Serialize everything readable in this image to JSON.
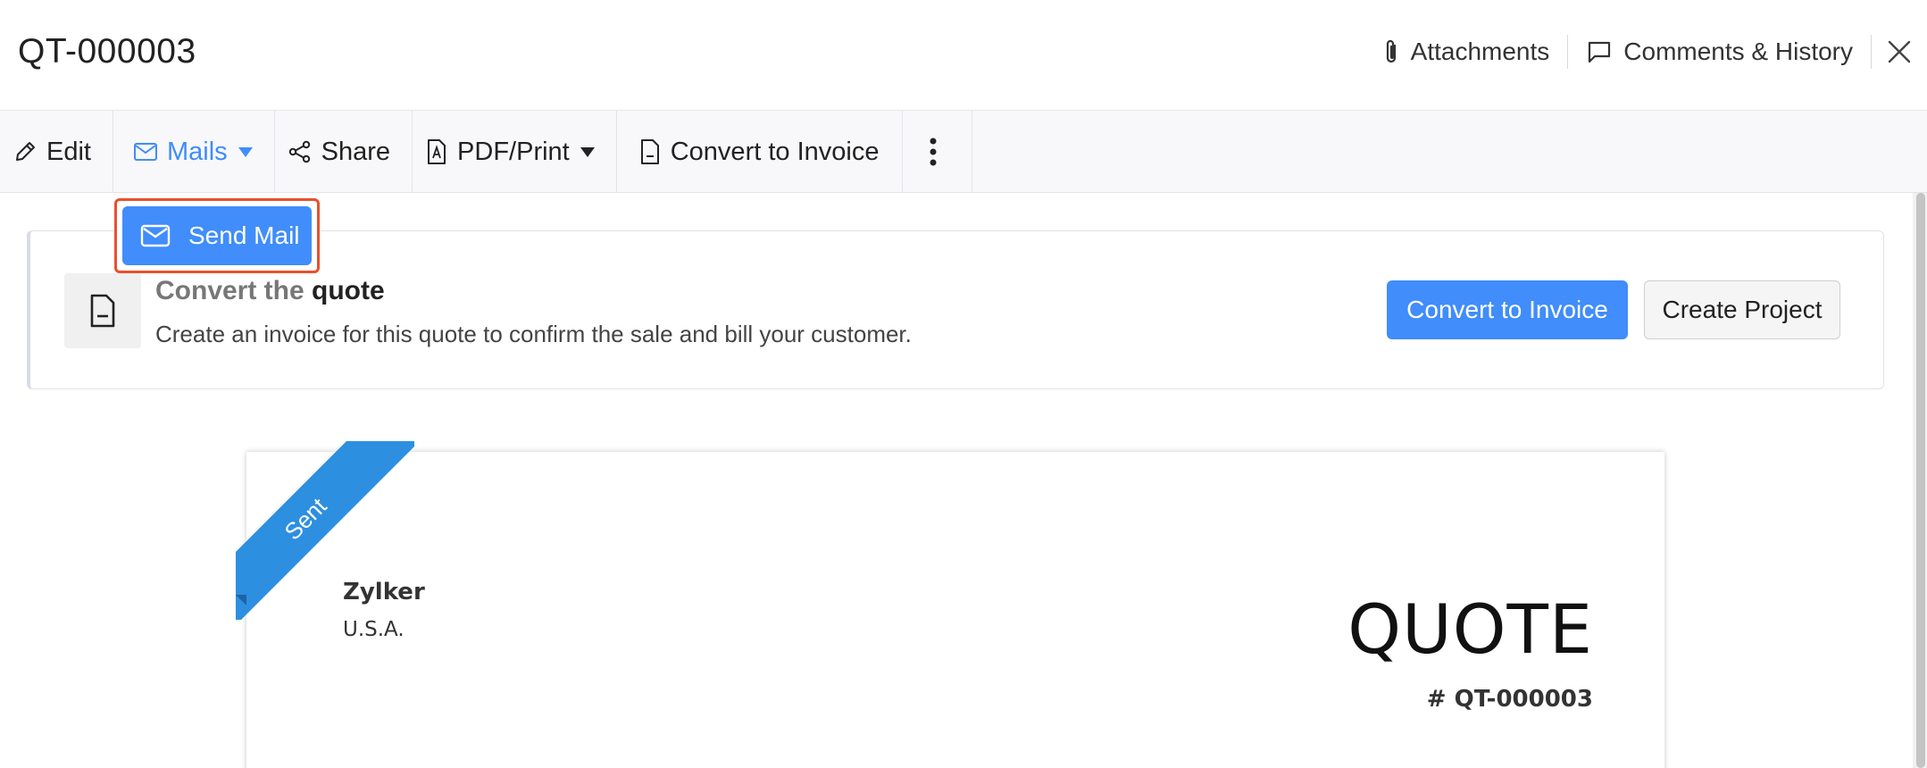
{
  "header": {
    "title": "QT-000003",
    "attachments_label": "Attachments",
    "comments_label": "Comments & History"
  },
  "toolbar": {
    "edit_label": "Edit",
    "mails_label": "Mails",
    "share_label": "Share",
    "pdf_label": "PDF/Print",
    "convert_label": "Convert to Invoice"
  },
  "dropdown": {
    "send_mail_label": "Send Mail"
  },
  "banner": {
    "title_part1": "Convert the",
    "title_part2": "quote",
    "subtitle": "Create an invoice for this quote to confirm the sale and bill your customer.",
    "convert_button": "Convert to Invoice",
    "project_button": "Create Project"
  },
  "document": {
    "status_ribbon": "Sent",
    "org_name": "Zylker",
    "org_country": "U.S.A.",
    "doc_title": "QUOTE",
    "doc_number": "# QT-000003"
  },
  "colors": {
    "accent": "#408dfb",
    "ribbon": "#2d8fe0",
    "highlight": "#e8502c"
  }
}
